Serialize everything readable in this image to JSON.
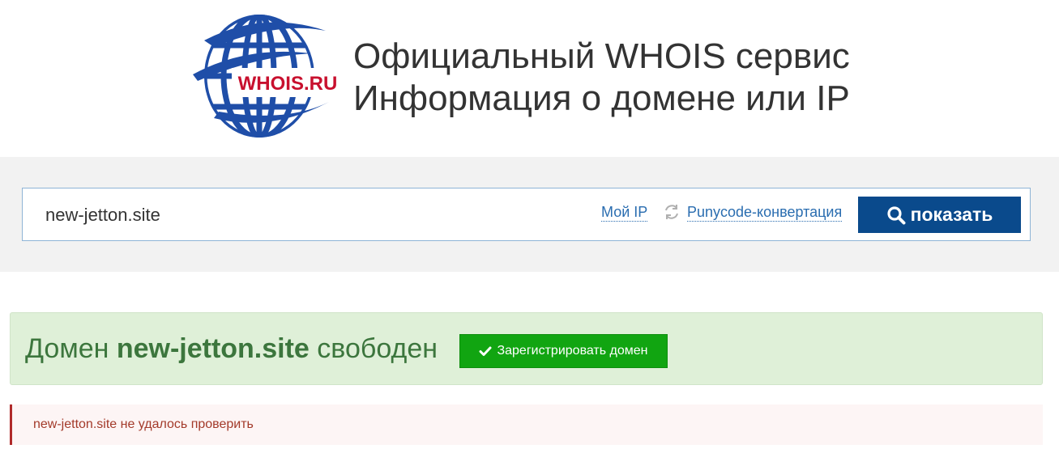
{
  "header": {
    "logo_text": "WHOIS.RU",
    "title_line1": "Официальный WHOIS сервис",
    "title_line2": "Информация о домене или IP"
  },
  "search": {
    "value": "new-jetton.site",
    "my_ip_label": "Мой IP",
    "punycode_label": "Punycode-конвертация",
    "show_label": "показать"
  },
  "result": {
    "prefix": "Домен ",
    "domain": "new-jetton.site",
    "suffix": " свободен",
    "register_label": "Зарегистрировать домен"
  },
  "warning": {
    "text": "new-jetton.site не удалось проверить"
  },
  "colors": {
    "brand_blue": "#0a4a8c",
    "link_blue": "#2a6db0",
    "success_bg": "#dff0d8",
    "success_text": "#3c763d",
    "register_green": "#11a511",
    "warning_red": "#b02a2a"
  }
}
